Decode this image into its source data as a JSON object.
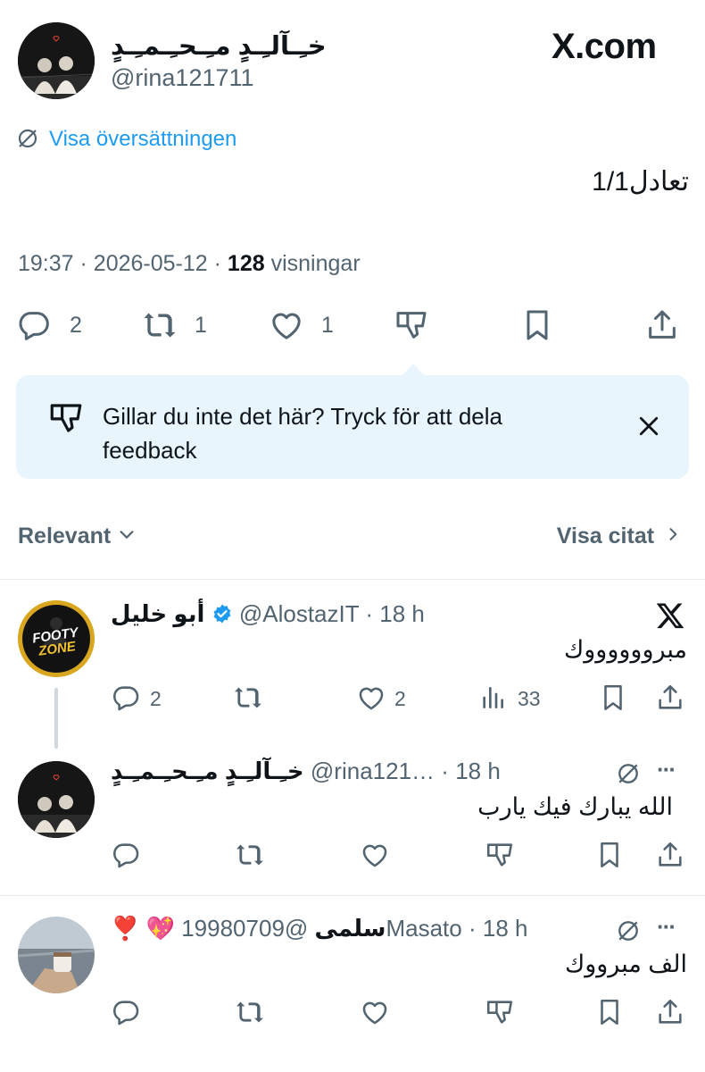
{
  "main_tweet": {
    "author_name": "خـِـآلـِـدٍ مـِـحـِـمـِـدٍ",
    "author_handle": "@rina121711",
    "site_label": "X.com",
    "translate_label": "Visa översättningen",
    "text": "1/1تعادل",
    "time": "19:37",
    "date": "2026-05-12",
    "views_count": "128",
    "views_label": "visningar",
    "replies": "2",
    "reposts": "1",
    "likes": "1"
  },
  "feedback": {
    "text": "Gillar du inte det här? Tryck för att dela feedback"
  },
  "sort": {
    "label": "Relevant",
    "quotes_label": "Visa citat"
  },
  "replies": [
    {
      "name": "أبو خليل",
      "handle": "@AlostazIT",
      "time": "18 h",
      "text": "مبرووووووك",
      "replies": "2",
      "likes": "2",
      "views": "33",
      "avatar_text_top": "FOOTY",
      "avatar_text_bottom": "ZONE"
    },
    {
      "name": "خـِـآلـِـدٍ مـِـحـِـمـِـدٍ",
      "handle": "@rina121…",
      "time": "18 h",
      "text": "الله يبارك فيك يارب",
      "more": "···"
    },
    {
      "name": "سلمى",
      "emoji": "❣️ 💖",
      "handle": "@19980709Masato",
      "time": "18 h",
      "text": "الف مبرووك",
      "more": "···"
    }
  ],
  "colors": {
    "link_blue": "#1d9bf0",
    "muted": "#536471",
    "feedback_bg": "#e8f5fd",
    "divider": "#e6ecf0"
  }
}
